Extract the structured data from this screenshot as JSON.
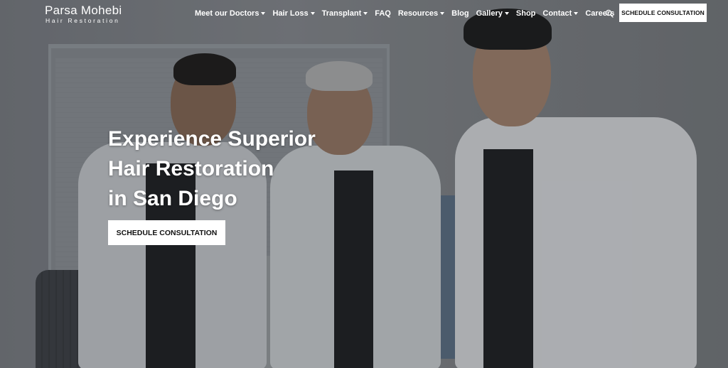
{
  "logo": {
    "name": "Parsa Mohebi",
    "tagline": "Hair Restoration"
  },
  "nav": {
    "items": [
      {
        "label": "Meet our Doctors",
        "dropdown": true
      },
      {
        "label": "Hair Loss",
        "dropdown": true
      },
      {
        "label": "Transplant",
        "dropdown": true
      },
      {
        "label": "FAQ",
        "dropdown": false
      },
      {
        "label": "Resources",
        "dropdown": true
      },
      {
        "label": "Blog",
        "dropdown": false
      },
      {
        "label": "Gallery",
        "dropdown": true
      },
      {
        "label": "Shop",
        "dropdown": false
      },
      {
        "label": "Contact",
        "dropdown": true
      },
      {
        "label": "Careers",
        "dropdown": false
      }
    ],
    "search_icon": "search-icon"
  },
  "header_cta": "SCHEDULE CONSULTATION",
  "hero": {
    "headline_lines": [
      "Experience Superior",
      "Hair Restoration",
      "in San Diego"
    ],
    "cta": "SCHEDULE CONSULTATION"
  },
  "colors": {
    "text": "#ffffff",
    "button_bg": "#ffffff",
    "button_text": "#111111"
  }
}
